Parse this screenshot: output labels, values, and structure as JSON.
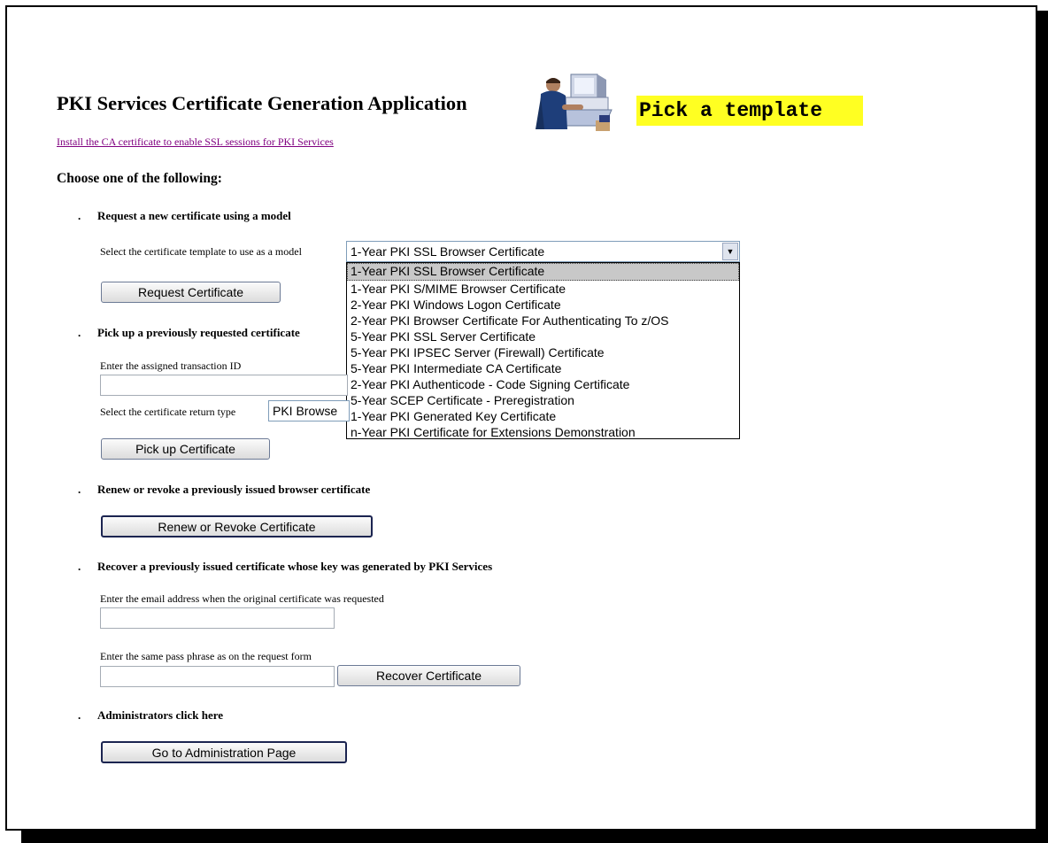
{
  "page": {
    "title": "PKI Services Certificate Generation Application",
    "banner": "Pick a template",
    "install_link": "Install the CA certificate to enable SSL sessions for PKI Services",
    "choose": "Choose one of the following:"
  },
  "request": {
    "heading": "Request a new certificate using a model",
    "select_label": "Select the certificate template to use as a model",
    "selected": "1-Year PKI SSL Browser Certificate",
    "options": [
      "1-Year PKI SSL Browser Certificate",
      "1-Year PKI S/MIME Browser Certificate",
      "2-Year PKI Windows Logon Certificate",
      "2-Year PKI Browser Certificate For Authenticating To z/OS",
      "5-Year PKI SSL Server Certificate",
      "5-Year PKI IPSEC Server (Firewall) Certificate",
      "5-Year PKI Intermediate CA Certificate",
      "2-Year PKI Authenticode - Code Signing Certificate",
      "5-Year SCEP Certificate - Preregistration",
      "1-Year PKI Generated Key Certificate",
      "n-Year PKI Certificate for Extensions Demonstration"
    ],
    "button": "Request Certificate"
  },
  "pickup": {
    "heading": "Pick up a previously requested certificate",
    "id_label": "Enter the assigned transaction ID",
    "id_value": "",
    "return_label": "Select the certificate return type",
    "return_value": "PKI Browse",
    "button": "Pick up Certificate"
  },
  "renew": {
    "heading": "Renew or revoke a previously issued browser certificate",
    "button": "Renew or Revoke Certificate"
  },
  "recover": {
    "heading": "Recover a previously issued certificate whose key was generated by PKI Services",
    "email_label": "Enter the email address when the original certificate was requested",
    "email_value": "",
    "pass_label": "Enter the same pass phrase as on the request form",
    "pass_value": "",
    "button": "Recover Certificate"
  },
  "admin": {
    "heading": "Administrators click here",
    "button": "Go to Administration Page"
  },
  "bullet_glyph": ".",
  "icons": {
    "illustration": "person-at-computer-icon",
    "dropdown_arrow": "chevron-down-icon"
  },
  "colors": {
    "banner_bg": "#ffff22",
    "link": "#800080"
  }
}
